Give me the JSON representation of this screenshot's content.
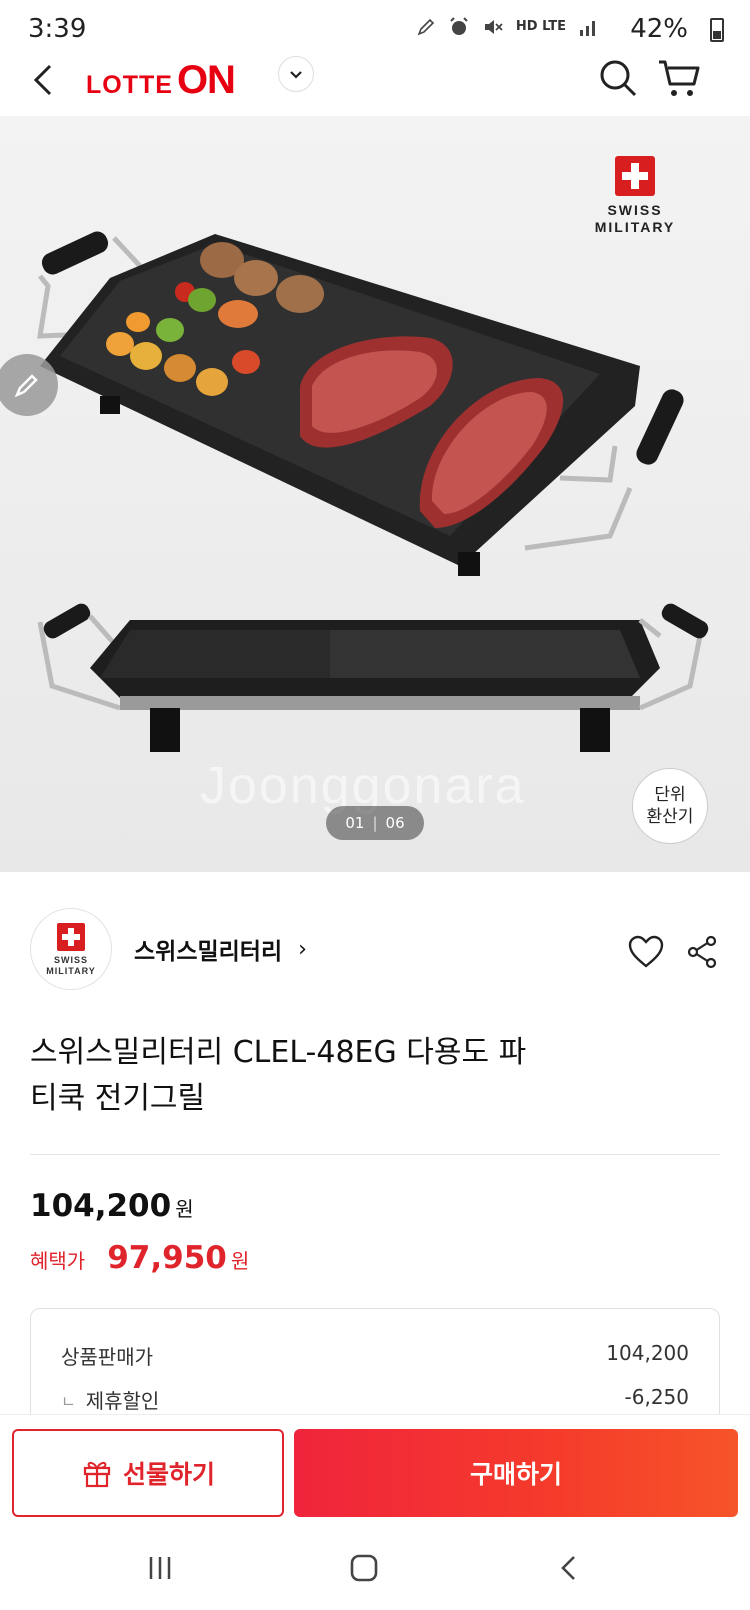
{
  "status_bar": {
    "time": "3:39",
    "network": "HD LTE",
    "battery": "42%"
  },
  "header": {
    "logo_left": "LOTTE",
    "logo_right": "ON"
  },
  "hero": {
    "brand_line1": "SWISS",
    "brand_line2": "MILITARY",
    "pager_current": "01",
    "pager_total": "06",
    "unit_converter_line1": "단위",
    "unit_converter_line2": "환산기",
    "watermark": "Joonggonara"
  },
  "seller": {
    "name": "스위스밀리터리",
    "logo_line1": "SWISS",
    "logo_line2": "MILITARY"
  },
  "product": {
    "title_line1": "스위스밀리터리 CLEL-48EG 다용도 파",
    "title_line2": "티쿡 전기그릴"
  },
  "pricing": {
    "price": "104,200",
    "currency": "원",
    "benefit_label": "혜택가",
    "benefit_price": "97,950",
    "rows": [
      {
        "label": "상품판매가",
        "value": "104,200"
      },
      {
        "label": "제휴할인",
        "value": "-6,250"
      }
    ]
  },
  "actions": {
    "gift_label": "선물하기",
    "buy_label": "구매하기"
  },
  "colors": {
    "brand_red": "#e60012",
    "accent_red": "#e0242b"
  }
}
